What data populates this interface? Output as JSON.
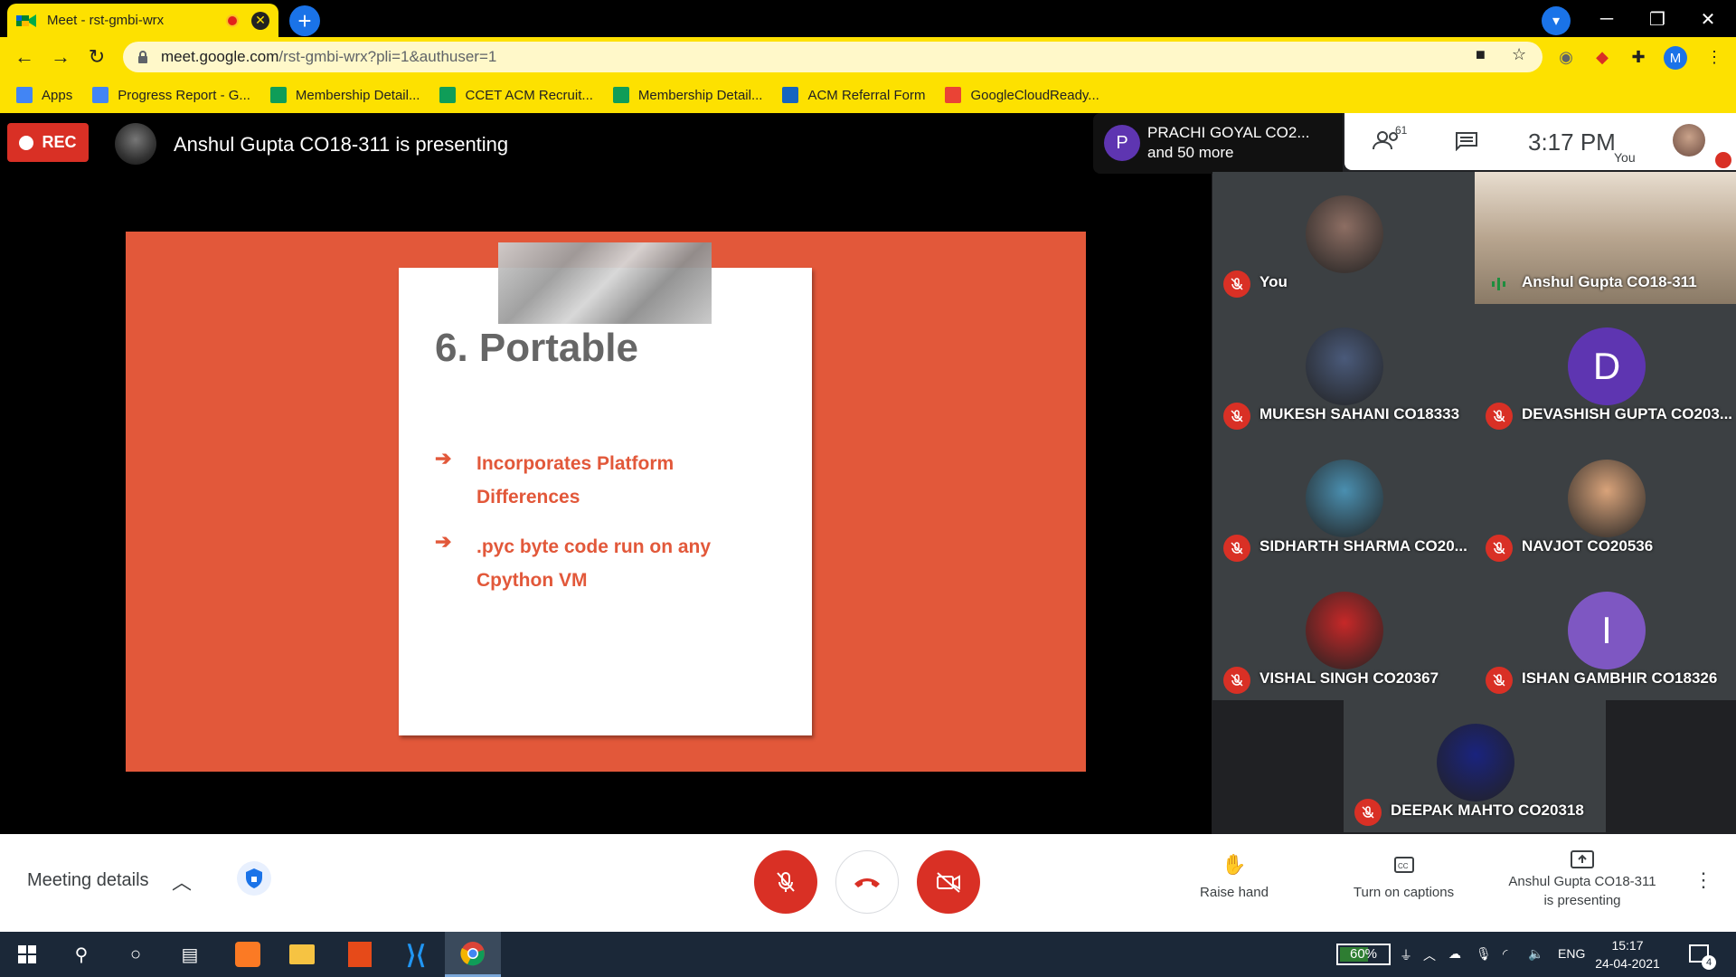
{
  "browser": {
    "tab_title": "Meet - rst-gmbi-wrx",
    "url_host": "meet.google.com",
    "url_path": "/rst-gmbi-wrx?pli=1&authuser=1",
    "avatar_letter": "M"
  },
  "bookmarks": [
    {
      "label": "Apps",
      "icon": "apps-grid-icon",
      "color": "#4285f4"
    },
    {
      "label": "Progress Report - G...",
      "icon": "docs-icon",
      "color": "#4285f4"
    },
    {
      "label": "Membership Detail...",
      "icon": "sheets-icon",
      "color": "#0f9d58"
    },
    {
      "label": "CCET ACM Recruit...",
      "icon": "sheets-icon",
      "color": "#0f9d58"
    },
    {
      "label": "Membership Detail...",
      "icon": "sheets-icon",
      "color": "#0f9d58"
    },
    {
      "label": "ACM Referral Form",
      "icon": "acm-icon",
      "color": "#1565c0"
    },
    {
      "label": "GoogleCloudReady...",
      "icon": "google-icon",
      "color": "#ea4335"
    }
  ],
  "meet": {
    "rec_label": "REC",
    "presenting_title": "Anshul Gupta CO18-311 is presenting",
    "people_line1": "PRACHI GOYAL CO2...",
    "people_line2": "and 50 more",
    "people_avatar_letter": "P",
    "participant_count": "61",
    "clock": "3:17  PM",
    "you_label": "You"
  },
  "slide": {
    "title": "6. Portable",
    "bullets": [
      {
        "arrow": "➔",
        "text": "Incorporates Platform Differences"
      },
      {
        "arrow": "➔",
        "text": ".pyc byte code run on any Cpython VM"
      }
    ]
  },
  "participants": [
    {
      "name": "You",
      "letter": "",
      "color": "#8d6e63"
    },
    {
      "name": "Anshul Gupta CO18-311",
      "letter": "",
      "color": "#b0a89a"
    },
    {
      "name": "MUKESH SAHANI CO18333",
      "letter": "",
      "color": "#4a5a7a"
    },
    {
      "name": "DEVASHISH GUPTA CO203...",
      "letter": "D",
      "color": "#5e35b1"
    },
    {
      "name": "SIDHARTH SHARMA CO20...",
      "letter": "",
      "color": "#4a8fb0"
    },
    {
      "name": "NAVJOT CO20536",
      "letter": "",
      "color": "#d9a37a"
    },
    {
      "name": "VISHAL SINGH CO20367",
      "letter": "",
      "color": "#c62828"
    },
    {
      "name": "ISHAN GAMBHIR CO18326",
      "letter": "I",
      "color": "#7e57c2"
    },
    {
      "name": "DEEPAK MAHTO CO20318",
      "letter": "",
      "color": "#1a237e"
    }
  ],
  "bottombar": {
    "meeting_details": "Meeting details",
    "raise_hand": "Raise hand",
    "captions": "Turn on captions",
    "presenting_line1": "Anshul Gupta CO18-311",
    "presenting_line2": "is presenting"
  },
  "taskbar": {
    "battery": "60%",
    "language": "ENG",
    "time": "15:17",
    "date": "24-04-2021",
    "notifications": "4"
  }
}
